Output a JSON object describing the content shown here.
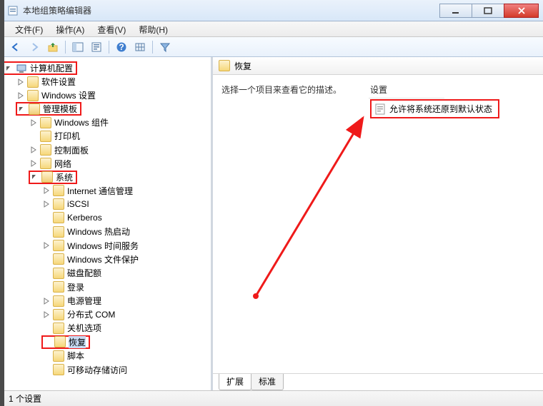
{
  "window": {
    "title": "本地组策略编辑器"
  },
  "menu": {
    "file": "文件(F)",
    "action": "操作(A)",
    "view": "查看(V)",
    "help": "帮助(H)"
  },
  "tree": {
    "root": "计算机配置",
    "soft": "软件设置",
    "winset": "Windows 设置",
    "admtpl": "管理模板",
    "wincomp": "Windows 组件",
    "printer": "打印机",
    "ctrlpanel": "控制面板",
    "network": "网络",
    "system": "系统",
    "inetcomm": "Internet 通信管理",
    "iscsi": "iSCSI",
    "kerberos": "Kerberos",
    "winhot": "Windows 热启动",
    "wintime": "Windows 时间服务",
    "winfile": "Windows 文件保护",
    "diskquota": "磁盘配额",
    "login": "登录",
    "power": "电源管理",
    "dcom": "分布式 COM",
    "shutdownopt": "关机选项",
    "recovery": "恢复",
    "scripts": "脚本",
    "removable": "可移动存储访问"
  },
  "right": {
    "header": "恢复",
    "desc": "选择一个项目来查看它的描述。",
    "settings_col": "设置",
    "setting_item": "允许将系统还原到默认状态",
    "tab_ext": "扩展",
    "tab_std": "标准"
  },
  "status": {
    "text": "1 个设置"
  }
}
